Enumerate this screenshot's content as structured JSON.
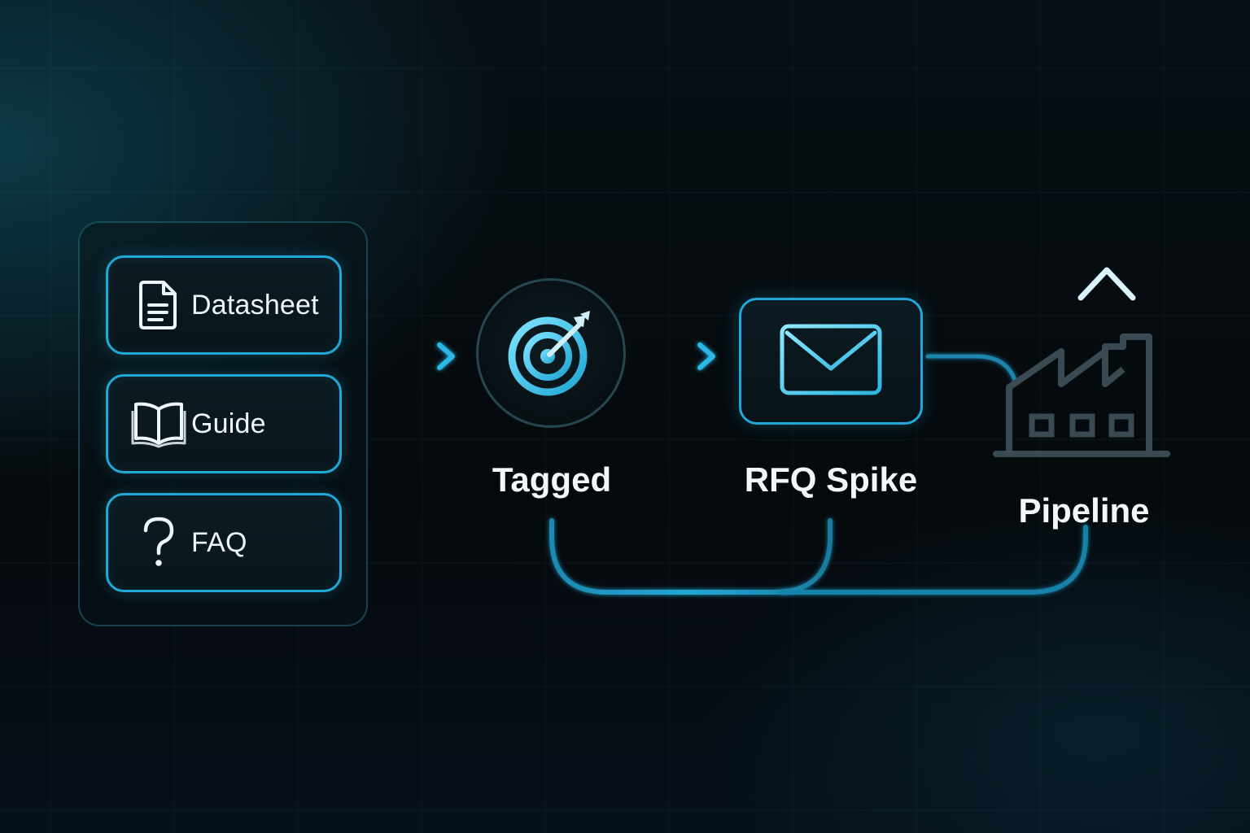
{
  "colors": {
    "accent": "#22a8d6",
    "accent_bright": "#39c6ee",
    "background": "#05090c",
    "text": "#f2f7f9",
    "muted_outline": "#3a4a52"
  },
  "sources": {
    "items": [
      {
        "label": "Datasheet",
        "icon": "document-icon"
      },
      {
        "label": "Guide",
        "icon": "open-book-icon"
      },
      {
        "label": "FAQ",
        "icon": "question-mark-icon"
      }
    ]
  },
  "nodes": {
    "tagged": {
      "label": "Tagged",
      "icon": "target-icon"
    },
    "rfq": {
      "label": "RFQ Spike",
      "icon": "envelope-icon"
    },
    "pipeline": {
      "label": "Pipeline",
      "icon": "factory-icon",
      "trend_icon": "arrow-up-icon"
    }
  }
}
